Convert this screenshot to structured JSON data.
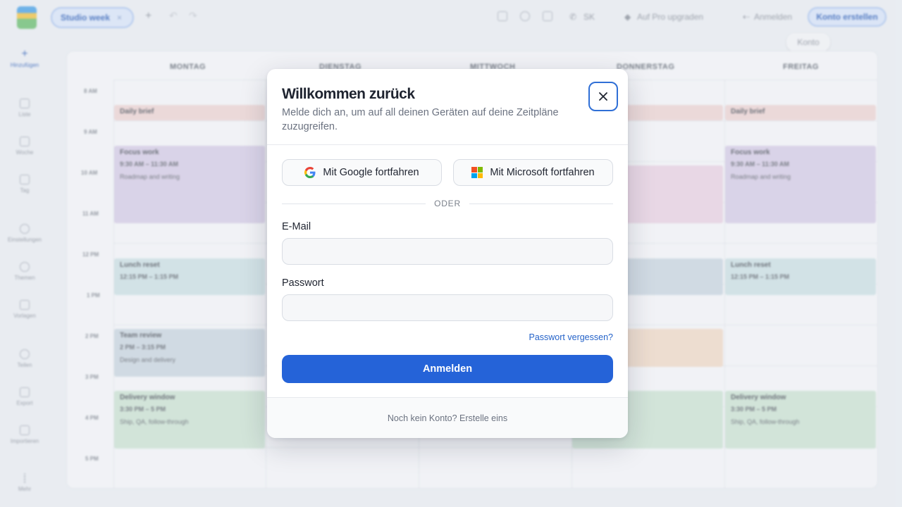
{
  "topbar": {
    "tab_label": "Studio week",
    "tab_close": "×",
    "sp_label": "SK",
    "upgrade_label": "Auf Pro upgraden",
    "login_label": "Anmelden",
    "create_account_label": "Konto erstellen",
    "tooltip_label": "Konto"
  },
  "sidebar": {
    "items": [
      {
        "label": "Hinzufügen",
        "icon": "plus-icon"
      },
      {
        "label": "Liste",
        "icon": "list-icon"
      },
      {
        "label": "Woche",
        "icon": "grid-icon"
      },
      {
        "label": "Tag",
        "icon": "calendar-icon"
      },
      {
        "label": "Einstellungen",
        "icon": "gear-icon"
      },
      {
        "label": "Themen",
        "icon": "palette-icon"
      },
      {
        "label": "Vorlagen",
        "icon": "template-icon"
      },
      {
        "label": "Teilen",
        "icon": "share-icon"
      },
      {
        "label": "Export",
        "icon": "export-icon"
      },
      {
        "label": "Importieren",
        "icon": "import-icon"
      },
      {
        "label": "Mehr",
        "icon": "more-icon"
      }
    ]
  },
  "calendar": {
    "days": [
      "MONTAG",
      "DIENSTAG",
      "MITTWOCH",
      "DONNERSTAG",
      "FREITAG"
    ],
    "times": [
      "8 AM",
      "9 AM",
      "10 AM",
      "11 AM",
      "12 PM",
      "1 PM",
      "2 PM",
      "3 PM",
      "4 PM",
      "5 PM"
    ],
    "events": {
      "daily_brief": "Daily brief",
      "focus_title": "Focus work",
      "focus_time": "9:30 AM – 11:30 AM",
      "focus_desc": "Roadmap and writing",
      "lunch_title": "Lunch reset",
      "lunch_time": "12:15 PM – 1:15 PM",
      "team_title": "Team review",
      "team_time": "2 PM – 3:15 PM",
      "team_desc": "Design and delivery",
      "delivery_title": "Delivery window",
      "delivery_time": "3:30 PM – 5 PM",
      "delivery_desc": "Ship, QA, follow-through"
    }
  },
  "modal": {
    "title": "Willkommen zurück",
    "subtitle": "Melde dich an, um auf all deinen Geräten auf deine Zeitpläne zuzugreifen.",
    "google_label": "Mit Google fortfahren",
    "microsoft_label": "Mit Microsoft fortfahren",
    "divider_label": "ODER",
    "email_label": "E-Mail",
    "email_value": "",
    "password_label": "Passwort",
    "password_value": "",
    "forgot_label": "Passwort vergessen?",
    "submit_label": "Anmelden",
    "footer_text": "Noch kein Konto? Erstelle eins"
  },
  "colors": {
    "accent": "#2563d8",
    "link": "#2563c9",
    "ms_red": "#f25022",
    "ms_green": "#7fba00",
    "ms_blue": "#00a4ef",
    "ms_yellow": "#ffb900"
  }
}
